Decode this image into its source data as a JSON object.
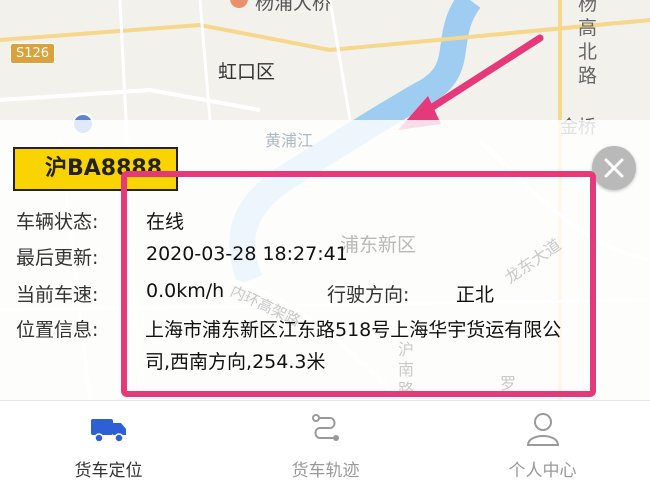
{
  "map": {
    "road_badge": "S126",
    "district_hongkou": "虹口区",
    "district_pudong": "浦东新区",
    "river": "黄浦江",
    "place_yangpu_bridge": "杨浦大桥",
    "road_yanggao": "杨高北路",
    "area_jinqiao": "金桥",
    "road_longdong": "龙东大道",
    "road_huhuan": "内环高架路",
    "road_hunan": "沪南路",
    "area_luo": "罗"
  },
  "vehicle": {
    "plate": "沪BA8888",
    "status_label": "车辆状态:",
    "status_value": "在线",
    "update_label": "最后更新:",
    "update_value": "2020-03-28 18:27:41",
    "speed_label": "当前车速:",
    "speed_value": "0.0km/h",
    "direction_label": "行驶方向:",
    "direction_value": "正北",
    "location_label": "位置信息:",
    "location_value": "上海市浦东新区江东路518号上海华宇货运有限公司,西南方向,254.3米"
  },
  "tabs": [
    {
      "label": "货车定位",
      "icon": "truck-icon",
      "active": true
    },
    {
      "label": "货车轨迹",
      "icon": "route-icon",
      "active": false
    },
    {
      "label": "个人中心",
      "icon": "person-icon",
      "active": false
    }
  ],
  "colors": {
    "accent": "#2f5fd6",
    "highlight": "#e6397a",
    "plate": "#f9d400",
    "inactive_tab": "#999999"
  }
}
